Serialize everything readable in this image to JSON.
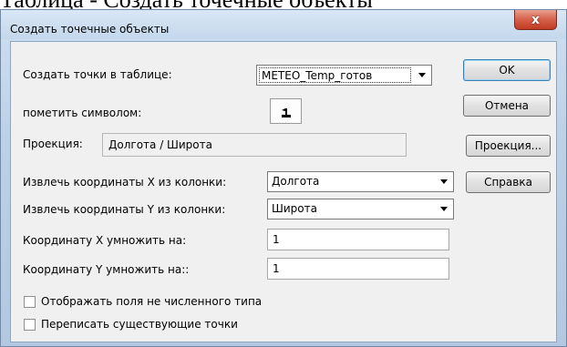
{
  "document": {
    "caption": "Таблица - Создать точечные объекты"
  },
  "window": {
    "title": "Создать точечные объекты",
    "close_label": "x"
  },
  "form": {
    "table_label": "Создать точки в таблице:",
    "table_value": "METEO_Temp_готов",
    "symbol_label": "пометить символом:",
    "projection_label": "Проекция:",
    "projection_value": "Долгота / Широта",
    "x_column_label": "Извлечь координаты X из колонки:",
    "x_column_value": "Долгота",
    "y_column_label": "Извлечь координаты Y из колонки:",
    "y_column_value": "Широта",
    "x_multiply_label": "Координату X умножить на:",
    "x_multiply_value": "1",
    "y_multiply_label": "Координату Y умножить на::",
    "y_multiply_value": "1",
    "checkbox_nonnumeric_label": "Отображать поля не численного типа",
    "checkbox_nonnumeric_checked": false,
    "checkbox_overwrite_label": "Переписать существующие точки",
    "checkbox_overwrite_checked": false
  },
  "buttons": {
    "ok": "OK",
    "cancel": "Отмена",
    "projection": "Проекция...",
    "help": "Справка"
  },
  "icons": {
    "symbol": "point-symbol-icon"
  }
}
